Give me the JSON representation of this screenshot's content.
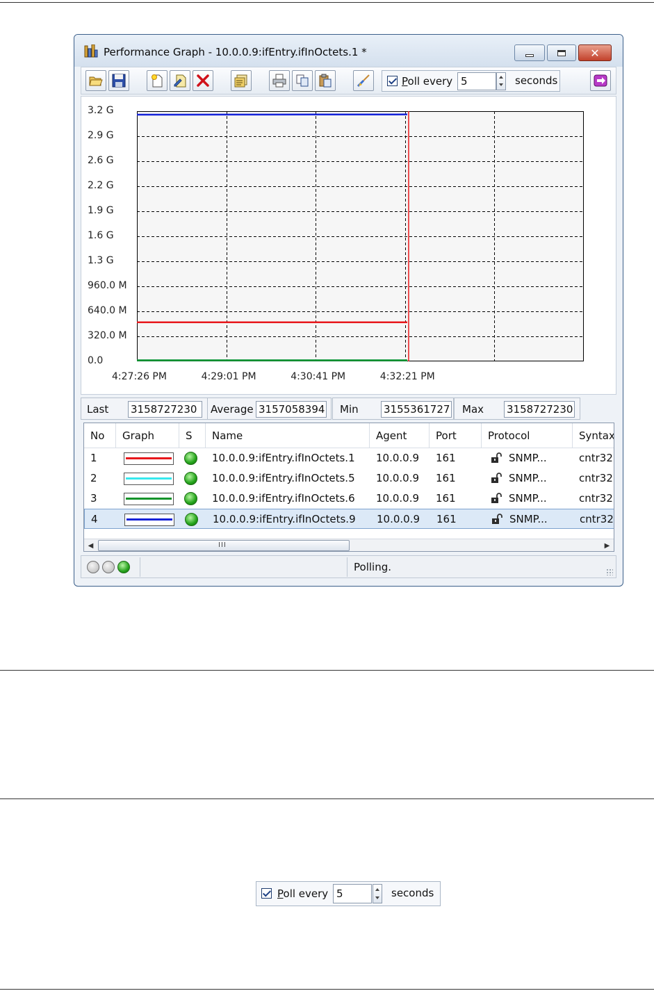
{
  "window": {
    "title": "Performance Graph - 10.0.0.9:ifEntry.ifInOctets.1 *"
  },
  "toolbar": {
    "buttons": [
      {
        "name": "open-button",
        "icon": "folder-open-icon"
      },
      {
        "name": "save-button",
        "icon": "floppy-disk-icon"
      },
      {
        "name": "new-button",
        "icon": "new-document-icon"
      },
      {
        "name": "edit-button",
        "icon": "edit-document-icon"
      },
      {
        "name": "delete-button",
        "icon": "red-x-icon"
      },
      {
        "name": "properties-button",
        "icon": "properties-icon"
      },
      {
        "name": "print-button",
        "icon": "printer-icon"
      },
      {
        "name": "copy-button",
        "icon": "copy-icon"
      },
      {
        "name": "paste-button",
        "icon": "paste-icon"
      },
      {
        "name": "settings-button",
        "icon": "brush-icon"
      },
      {
        "name": "exit-button",
        "icon": "exit-icon"
      }
    ],
    "poll": {
      "checked": true,
      "label_ul": "P",
      "label_rest": "oll every",
      "interval": "5",
      "unit": "seconds"
    }
  },
  "chart_data": {
    "type": "line",
    "y_ticks": [
      "3.2 G",
      "2.9 G",
      "2.6 G",
      "2.2 G",
      "1.9 G",
      "1.6 G",
      "1.3 G",
      "960.0 M",
      "640.0 M",
      "320.0 M",
      "0.0"
    ],
    "x_ticks": [
      "4:27:26 PM",
      "4:29:01 PM",
      "4:30:41 PM",
      "4:32:21 PM"
    ],
    "ylim": [
      0,
      3200000000
    ],
    "grid": true,
    "cursor_fraction": 0.608,
    "series": [
      {
        "color": "#e8181c",
        "points": [
          [
            0,
            500000000
          ],
          [
            0.605,
            500000000
          ]
        ]
      },
      {
        "color": "#23c8d8",
        "points": [
          [
            0,
            2000000
          ],
          [
            0.605,
            2000000
          ]
        ]
      },
      {
        "color": "#12932a",
        "points": [
          [
            0,
            2000000
          ],
          [
            0.605,
            2000000
          ]
        ]
      },
      {
        "color": "#1422d8",
        "points": [
          [
            0,
            3155361727
          ],
          [
            0.06,
            3155700000
          ],
          [
            0.2,
            3156300000
          ],
          [
            0.4,
            3157100000
          ],
          [
            0.5,
            3157800000
          ],
          [
            0.58,
            3158400000
          ],
          [
            0.605,
            3158727230
          ]
        ]
      }
    ]
  },
  "stats": {
    "last_label": "Last",
    "last_value": "3158727230",
    "avg_label": "Average",
    "avg_value": "3157058394",
    "min_label": "Min",
    "min_value": "3155361727",
    "max_label": "Max",
    "max_value": "3158727230"
  },
  "table": {
    "headers": [
      "No",
      "Graph",
      "S",
      "Name",
      "Agent",
      "Port",
      "Protocol",
      "Syntax"
    ],
    "rows": [
      {
        "no": "1",
        "color": "#e8181c",
        "name": "10.0.0.9:ifEntry.ifInOctets.1",
        "agent": "10.0.0.9",
        "port": "161",
        "protocol": "SNMP...",
        "syntax": "cntr32"
      },
      {
        "no": "2",
        "color": "#35e8ee",
        "name": "10.0.0.9:ifEntry.ifInOctets.5",
        "agent": "10.0.0.9",
        "port": "161",
        "protocol": "SNMP...",
        "syntax": "cntr32"
      },
      {
        "no": "3",
        "color": "#12932a",
        "name": "10.0.0.9:ifEntry.ifInOctets.6",
        "agent": "10.0.0.9",
        "port": "161",
        "protocol": "SNMP...",
        "syntax": "cntr32"
      },
      {
        "no": "4",
        "color": "#1422d8",
        "name": "10.0.0.9:ifEntry.ifInOctets.9",
        "agent": "10.0.0.9",
        "port": "161",
        "protocol": "SNMP...",
        "syntax": "cntr32"
      }
    ],
    "selected_row": 3,
    "scroll_grip": "III"
  },
  "statusbar": {
    "text": "Polling."
  },
  "poll_standalone": {
    "label_ul": "P",
    "label_rest": "oll every",
    "interval": "5",
    "unit": "seconds"
  }
}
